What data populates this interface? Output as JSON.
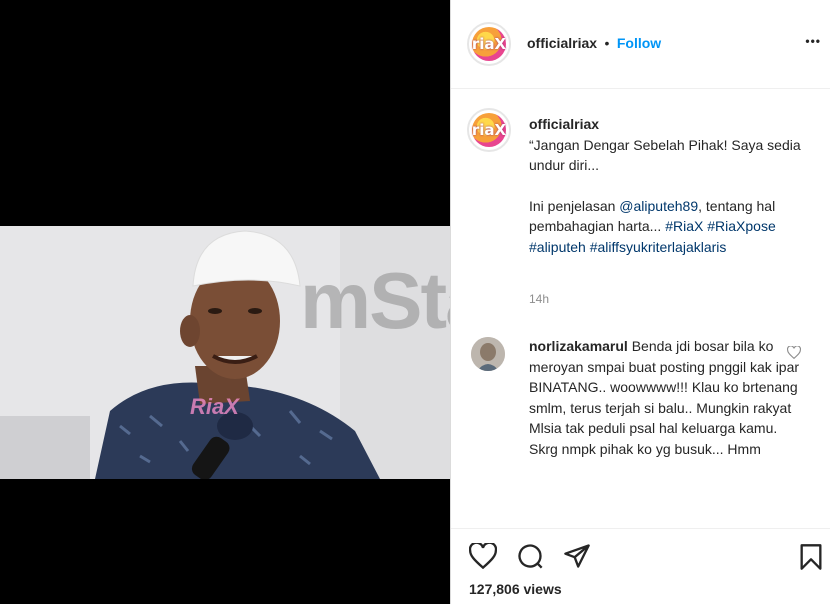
{
  "post": {
    "username": "officialriax",
    "follow_label": "Follow",
    "dot": "•",
    "more_label": "•••",
    "caption_username": "officialriax",
    "caption_line1": "“Jangan Dengar Sebelah Pihak! Saya sedia undur diri...",
    "caption_text_a": "Ini penjelasan ",
    "caption_mention": "@aliputeh89",
    "caption_text_b": ", tentang hal pembahagian harta... ",
    "hashtags": [
      "#RiaX",
      "#RiaXpose",
      "#aliputeh",
      "#aliffsyukriterlajaklaris"
    ],
    "timestamp": "14h",
    "views": "127,806 views"
  },
  "comment": {
    "username": "norlizakamarul",
    "text": "Benda jdi bosar bila ko meroyan smpai buat posting pnggil kak ipar BINATANG.. woowwww!!! Klau ko brtenang smlm, terus terjah si balu.. Mungkin rakyat Mlsia tak peduli psal hal keluarga kamu. Skrg nmpk pihak ko yg busuk... Hmm"
  },
  "media": {
    "overlay_logo": "RiaX"
  },
  "watermark": {
    "mstar": "mStar"
  },
  "icons": {
    "avatar_logo": "riaX",
    "like": "heart-icon",
    "comment": "comment-icon",
    "share": "paper-plane-icon",
    "save": "bookmark-icon",
    "comment_like": "small-heart-icon"
  },
  "colors": {
    "follow": "#0095f6",
    "text": "#262626",
    "muted": "#8e8e8e"
  }
}
